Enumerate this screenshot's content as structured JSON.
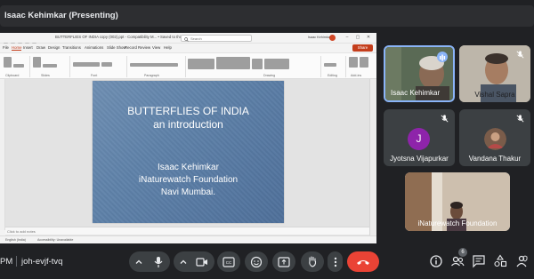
{
  "banner": {
    "presenting_text": "Isaac Kehimkar (Presenting)"
  },
  "powerpoint": {
    "title": "BUTTERFLIES OF INDIA copy (002).ppt - Compatibility M... • Saved to this PC",
    "search_placeholder": "Search",
    "user_name": "Isaac Kehimkar",
    "tabs": [
      "File",
      "Home",
      "Insert",
      "Draw",
      "Design",
      "Transitions",
      "Animations",
      "Slide Show",
      "Record",
      "Review",
      "View",
      "Help"
    ],
    "active_tab": "Home",
    "share_label": "Share",
    "ribbon_groups": [
      "Clipboard",
      "Slides",
      "Font",
      "Paragraph",
      "Drawing",
      "Editing",
      "Add-ins"
    ],
    "notes_placeholder": "Click to add notes",
    "status_left": "English (India)",
    "status_accessibility": "Accessibility: Unavailable",
    "slide": {
      "title": "BUTTERFLIES OF INDIA",
      "subtitle": "an introduction",
      "lines": [
        "Isaac Kehimkar",
        "iNaturewatch Foundation",
        "Navi Mumbai."
      ]
    }
  },
  "participants": [
    {
      "name": "Isaac Kehimkar",
      "status": "speaking"
    },
    {
      "name": "Vishal Sapra",
      "status": "muted"
    },
    {
      "name": "Jyotsna Vijapurkar",
      "initial": "J",
      "status": "muted"
    },
    {
      "name": "Vandana Thakur",
      "status": "muted"
    },
    {
      "name": "iNaturewatch Foundation",
      "status": "video"
    }
  ],
  "bottom_bar": {
    "time_fragment": "PM",
    "meeting_code": "joh-evjf-tvq",
    "people_count": "6"
  },
  "colors": {
    "background": "#202124",
    "tile": "#3c4043",
    "end_call": "#ea4335",
    "accent_blue": "#8ab4f8",
    "ppt_accent": "#c43e1c"
  }
}
